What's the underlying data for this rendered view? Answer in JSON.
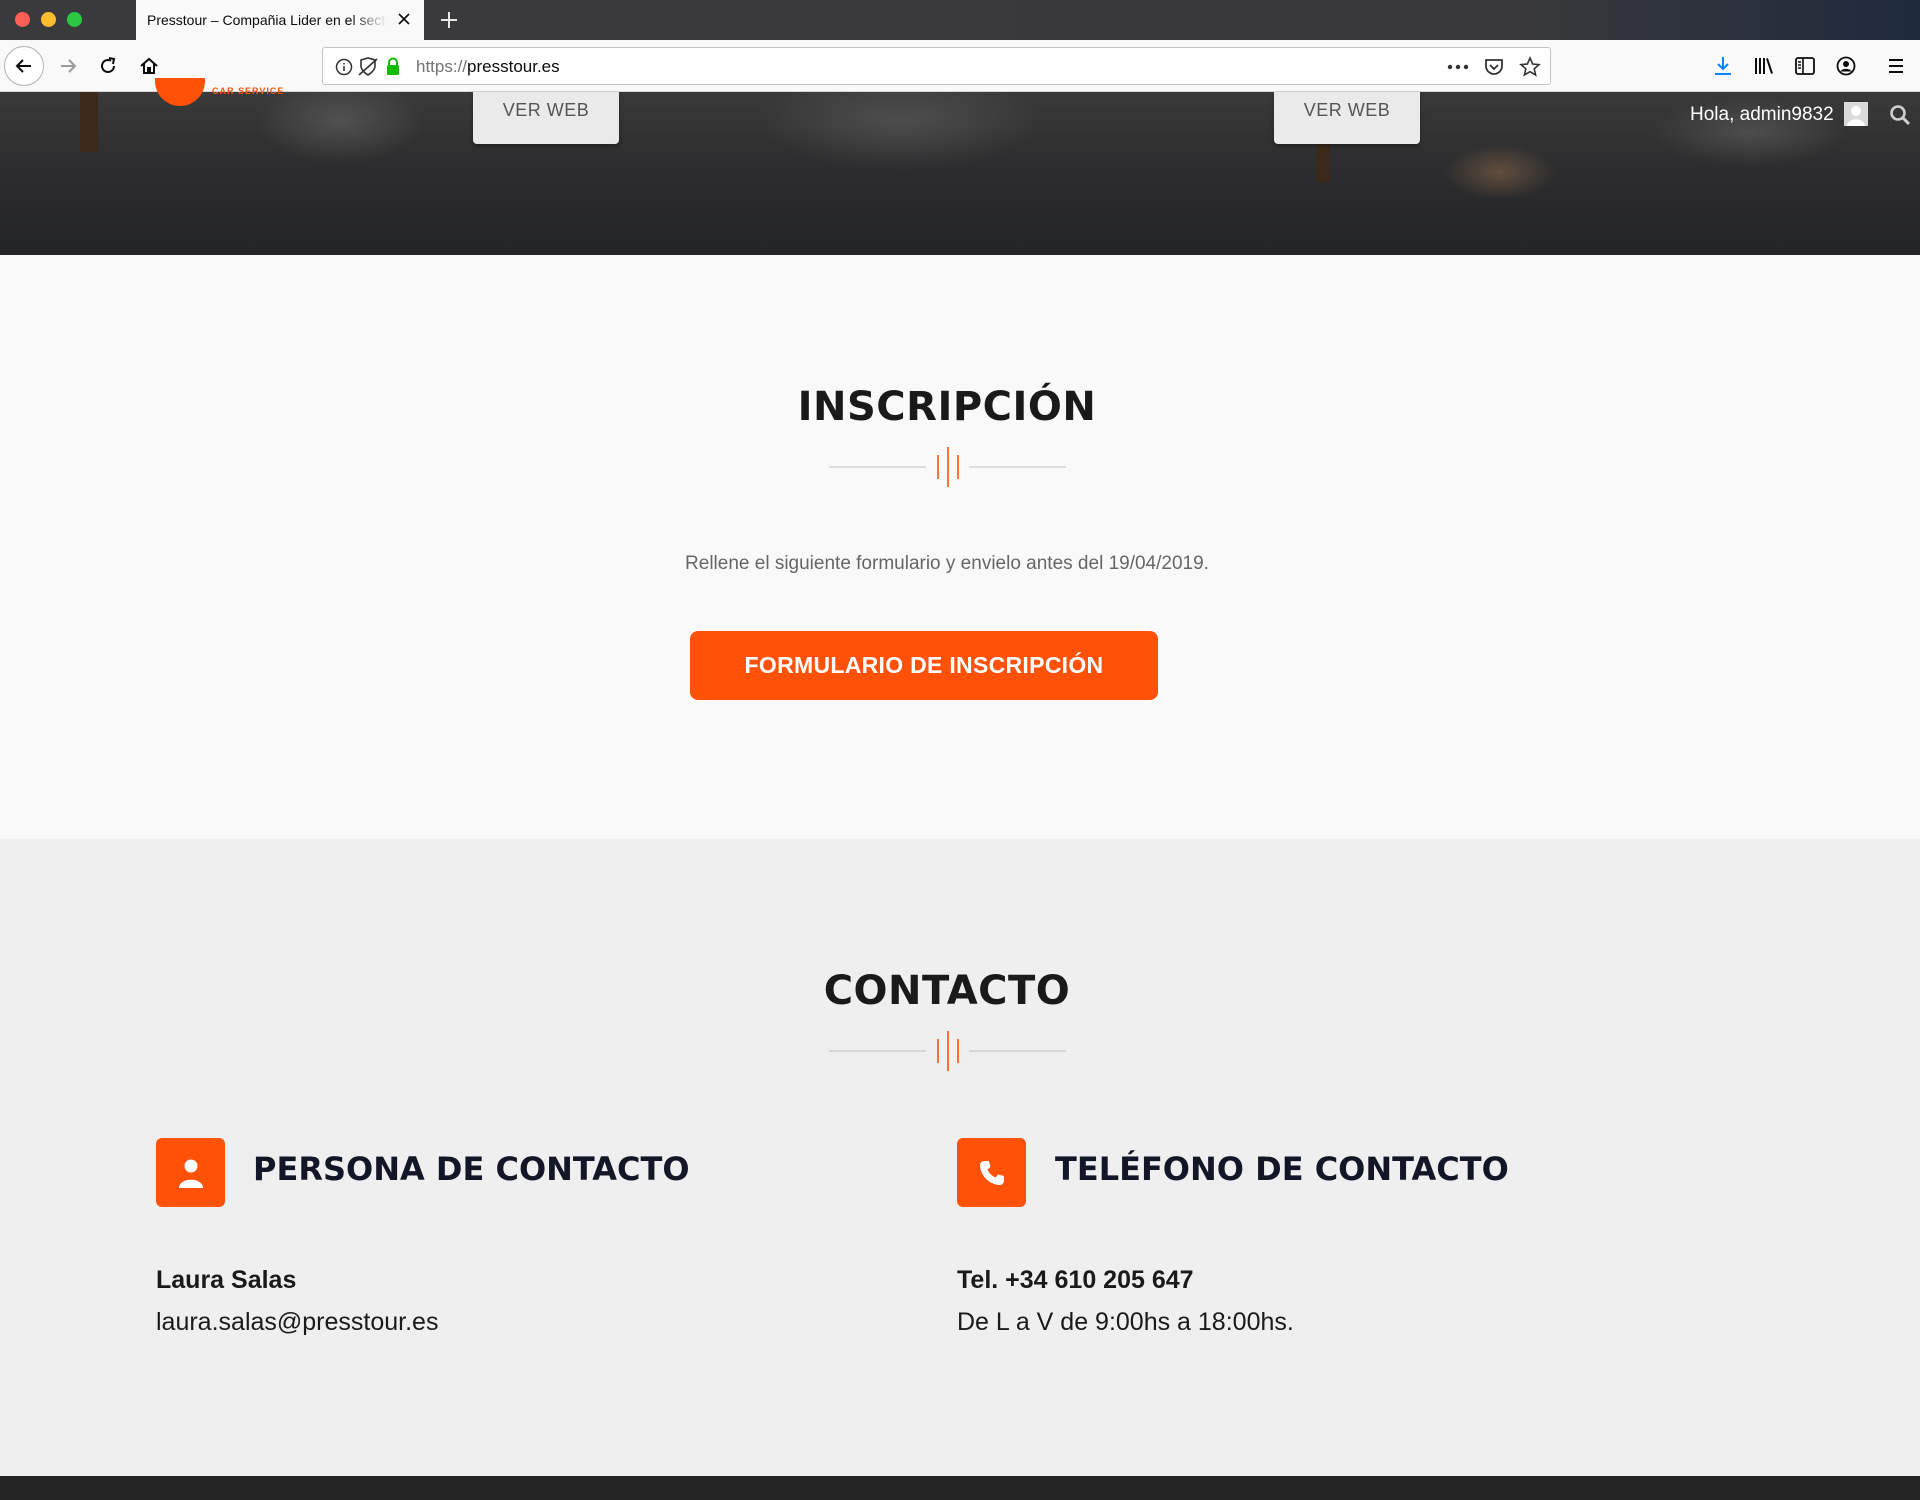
{
  "browser": {
    "tab_title": "Presstour – Compañia Lider en el sector",
    "url_scheme": "https://",
    "url_host": "presstour.es"
  },
  "hero": {
    "logo_subtitle": "CAR SERVICE",
    "ver_web_left": "VER WEB",
    "ver_web_right": "VER WEB",
    "greeting": "Hola, admin9832"
  },
  "inscripcion": {
    "title": "INSCRIPCIÓN",
    "text": "Rellene el siguiente formulario y envielo antes del 19/04/2019.",
    "button": "FORMULARIO DE INSCRIPCIÓN"
  },
  "contacto": {
    "title": "CONTACTO",
    "persona": {
      "heading": "PERSONA DE CONTACTO",
      "name": "Laura Salas",
      "email": "laura.salas@presstour.es"
    },
    "telefono": {
      "heading": "TELÉFONO DE CONTACTO",
      "phone": "Tel. +34 610 205 647",
      "hours": "De L a V de 9:00hs a 18:00hs."
    }
  },
  "colors": {
    "accent": "#ff5108",
    "heading_dark": "#131626",
    "section_light": "#f9f9f9",
    "section_grey": "#efefef",
    "footer": "#242424"
  },
  "icons": [
    "back-arrow-icon",
    "forward-arrow-icon",
    "reload-icon",
    "home-icon",
    "info-icon",
    "tracking-protection-icon",
    "lock-icon",
    "more-icon",
    "pocket-icon",
    "star-icon",
    "download-icon",
    "library-icon",
    "sidebar-icon",
    "account-icon",
    "menu-icon",
    "search-icon",
    "user-icon",
    "phone-icon"
  ]
}
